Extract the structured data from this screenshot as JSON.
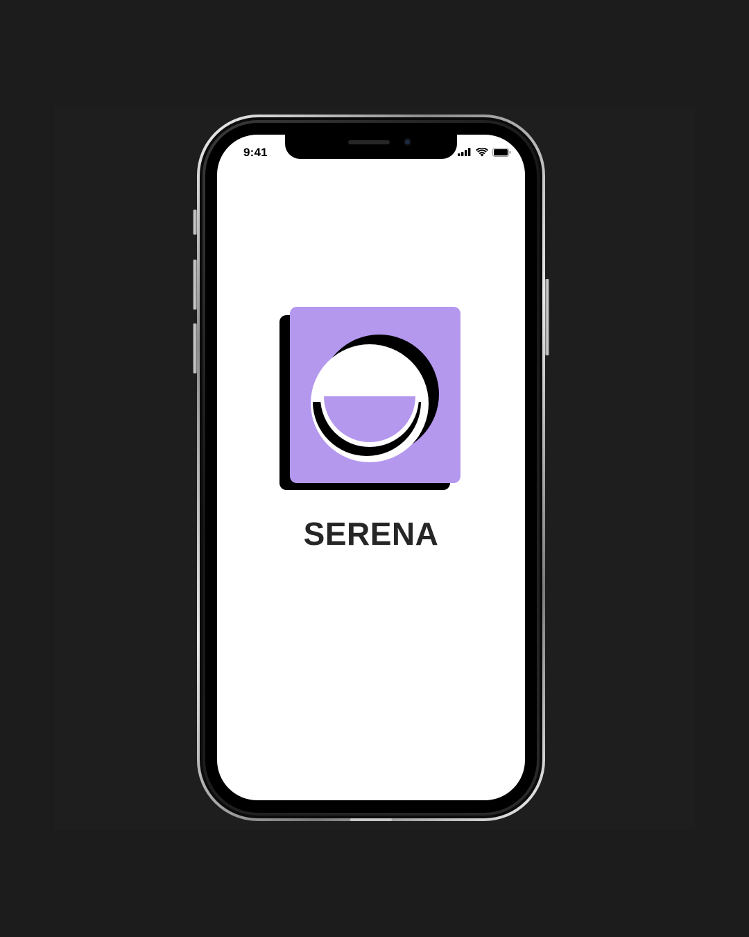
{
  "status_bar": {
    "time": "9:41",
    "icons": [
      "signal-icon",
      "wifi-icon",
      "battery-icon"
    ]
  },
  "splash": {
    "app_name": "SERENA",
    "logo": "smiling-face-logo"
  },
  "colors": {
    "background": "#1c1c1c",
    "accent": "#b498ee",
    "logo_shadow": "#000000",
    "screen": "#ffffff",
    "text": "#262626"
  }
}
